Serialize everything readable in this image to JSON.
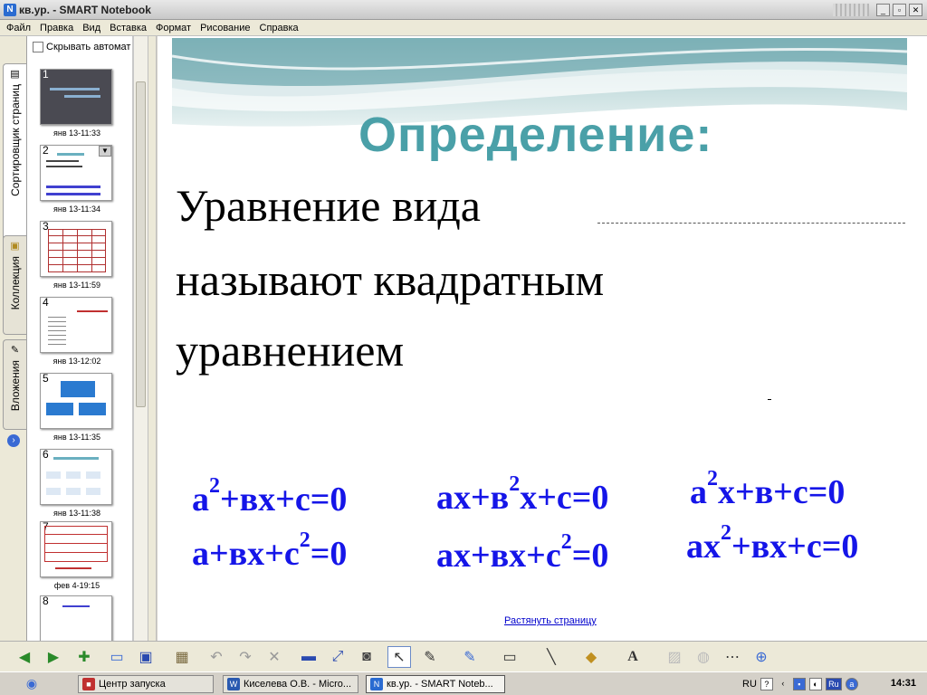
{
  "window": {
    "title": "кв.ур. - SMART Notebook"
  },
  "menu": [
    "Файл",
    "Правка",
    "Вид",
    "Вставка",
    "Формат",
    "Рисование",
    "Справка"
  ],
  "side_tabs": {
    "sorter": "Сортировщик страниц",
    "gallery": "Коллекция",
    "attachments": "Вложения"
  },
  "sorter": {
    "hide_auto_label": "Скрывать автомат",
    "pages": [
      {
        "number": "1",
        "date": "янв 13-11:33"
      },
      {
        "number": "2",
        "date": "янв 13-11:34"
      },
      {
        "number": "3",
        "date": "янв 13-11:59"
      },
      {
        "number": "4",
        "date": "янв 13-12:02"
      },
      {
        "number": "5",
        "date": "янв 13-11:35"
      },
      {
        "number": "6",
        "date": "янв 13-11:38"
      },
      {
        "number": "7",
        "date": "фев 4-19:15"
      },
      {
        "number": "8",
        "date": ""
      }
    ]
  },
  "slide": {
    "heading": "Определение:",
    "definition": [
      "Уравнение вида",
      "называют квадратным",
      "уравнением"
    ],
    "equations": [
      {
        "id": "e1",
        "parts": [
          "a",
          "2",
          "+вх+с=0"
        ]
      },
      {
        "id": "e2",
        "parts": [
          "ах+в",
          "2",
          "х+с=0"
        ]
      },
      {
        "id": "e3",
        "parts": [
          "a",
          "2",
          "x+в+с=0"
        ]
      },
      {
        "id": "e4",
        "parts": [
          "a+вх+с",
          "2",
          "=0"
        ]
      },
      {
        "id": "e5",
        "parts": [
          "ах+вх+с",
          "2",
          "=0"
        ]
      },
      {
        "id": "e6",
        "parts": [
          "ax",
          "2",
          "+вх+с=0"
        ]
      }
    ],
    "stretch_link": "Растянуть страницу"
  },
  "taskbar": {
    "tasks": [
      {
        "label": "Центр запуска"
      },
      {
        "label": "Киселева О.В. - Micro..."
      },
      {
        "label": "кв.ур. - SMART Noteb..."
      }
    ],
    "lang": "RU",
    "ime": "Ru",
    "clock": "14:31"
  },
  "colors": {
    "heading": "#4aa0a8",
    "equation": "#1515e8"
  }
}
